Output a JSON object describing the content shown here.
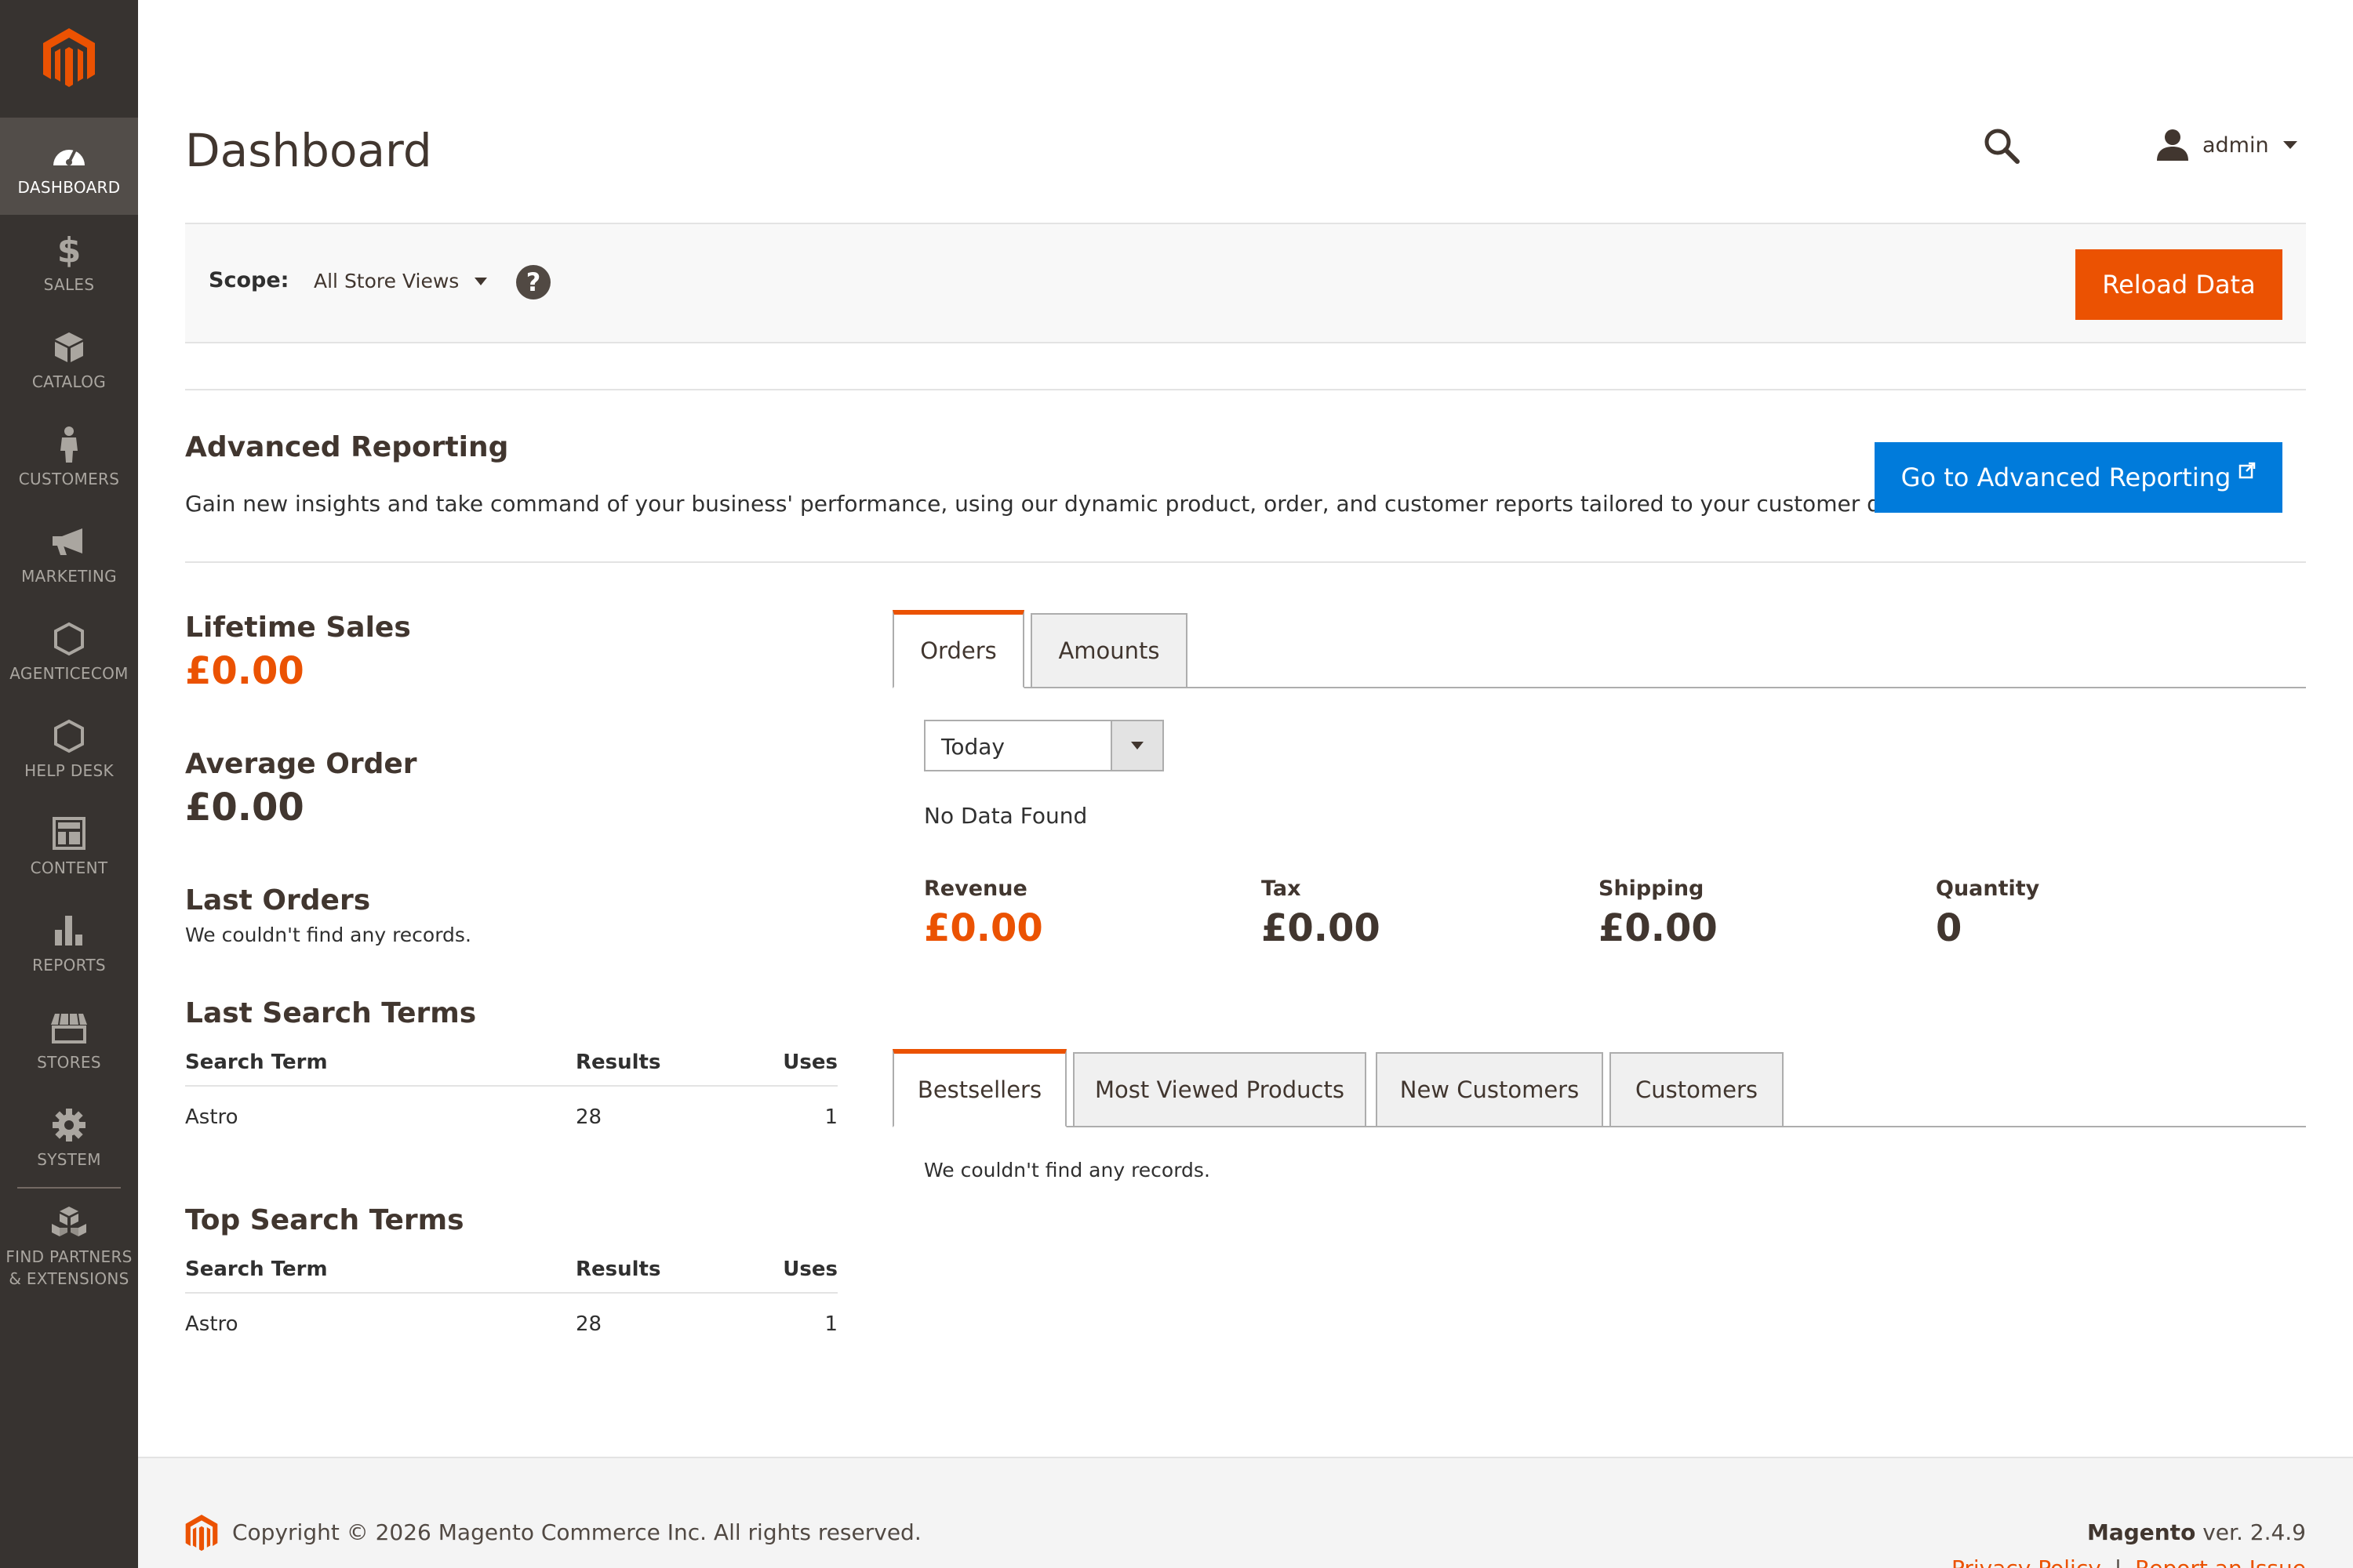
{
  "app": {
    "brand_color": "#eb5202",
    "sidebar_bg": "#373330",
    "link_blue": "#007bdb"
  },
  "sidebar": {
    "items": [
      {
        "label": "DASHBOARD",
        "icon": "dashboard-gauge-icon",
        "active": true
      },
      {
        "label": "SALES",
        "icon": "dollar-icon"
      },
      {
        "label": "CATALOG",
        "icon": "box-icon"
      },
      {
        "label": "CUSTOMERS",
        "icon": "person-icon"
      },
      {
        "label": "MARKETING",
        "icon": "megaphone-icon"
      },
      {
        "label": "AGENTICECOM",
        "icon": "hexagon-icon"
      },
      {
        "label": "HELP DESK",
        "icon": "hexagon-icon"
      },
      {
        "label": "CONTENT",
        "icon": "layout-icon"
      },
      {
        "label": "REPORTS",
        "icon": "bar-chart-icon"
      },
      {
        "label": "STORES",
        "icon": "storefront-icon"
      },
      {
        "label": "SYSTEM",
        "icon": "gear-icon"
      }
    ],
    "extensions": {
      "line1": "FIND PARTNERS",
      "line2": "& EXTENSIONS",
      "icon": "cubes-icon"
    }
  },
  "header": {
    "title": "Dashboard",
    "user": "admin"
  },
  "scope": {
    "label": "Scope:",
    "value": "All Store Views",
    "help": "?",
    "reload": "Reload Data"
  },
  "advanced_reporting": {
    "title": "Advanced Reporting",
    "description": "Gain new insights and take command of your business' performance, using our dynamic product, order, and customer reports tailored to your customer data.",
    "button": "Go to Advanced Reporting"
  },
  "stats": {
    "lifetime_sales": {
      "label": "Lifetime Sales",
      "value": "£0.00"
    },
    "average_order": {
      "label": "Average Order",
      "value": "£0.00"
    },
    "last_orders": {
      "label": "Last Orders",
      "empty": "We couldn't find any records."
    }
  },
  "last_search_terms": {
    "title": "Last Search Terms",
    "headers": [
      "Search Term",
      "Results",
      "Uses"
    ],
    "rows": [
      [
        "Astro",
        "28",
        "1"
      ]
    ]
  },
  "top_search_terms": {
    "title": "Top Search Terms",
    "headers": [
      "Search Term",
      "Results",
      "Uses"
    ],
    "rows": [
      [
        "Astro",
        "28",
        "1"
      ]
    ]
  },
  "chart_tabs": {
    "tabs": [
      "Orders",
      "Amounts"
    ],
    "period": "Today",
    "empty": "No Data Found"
  },
  "totals": [
    {
      "label": "Revenue",
      "value": "£0.00"
    },
    {
      "label": "Tax",
      "value": "£0.00"
    },
    {
      "label": "Shipping",
      "value": "£0.00"
    },
    {
      "label": "Quantity",
      "value": "0"
    }
  ],
  "grid_tabs": {
    "tabs": [
      "Bestsellers",
      "Most Viewed Products",
      "New Customers",
      "Customers"
    ],
    "empty": "We couldn't find any records."
  },
  "footer": {
    "copyright": "Copyright © 2026 Magento Commerce Inc. All rights reserved.",
    "brand": "Magento",
    "version": " ver. 2.4.9",
    "links": [
      "Privacy Policy",
      "Report an Issue"
    ],
    "separator": "|"
  }
}
